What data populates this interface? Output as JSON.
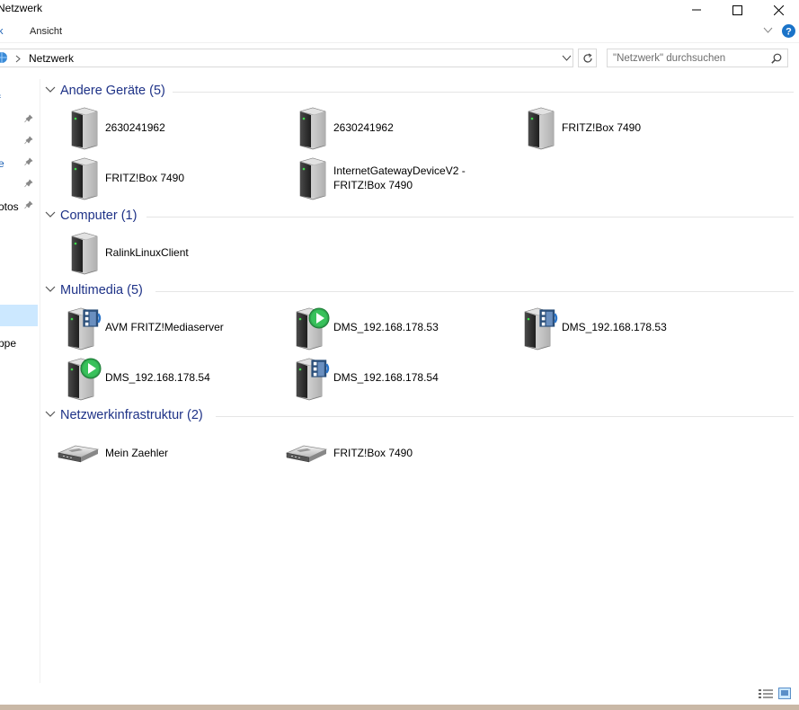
{
  "window": {
    "title": "Netzwerk"
  },
  "ribbon": {
    "tabs": [
      "k",
      "Ansicht"
    ]
  },
  "address": {
    "location": "Netzwerk"
  },
  "search": {
    "placeholder": "\"Netzwerk\" durchsuchen"
  },
  "nav": {
    "items": [
      "f",
      "",
      "e",
      "",
      "otos",
      "",
      "ppe"
    ]
  },
  "groups": [
    {
      "title": "Andere Geräte (5)",
      "items": [
        {
          "label": "2630241962",
          "icon": "server-tower-icon"
        },
        {
          "label": "2630241962",
          "icon": "server-tower-icon"
        },
        {
          "label": "FRITZ!Box 7490",
          "icon": "server-tower-icon"
        },
        {
          "label": "FRITZ!Box 7490",
          "icon": "server-tower-icon"
        },
        {
          "label": "InternetGatewayDeviceV2 -",
          "label2": "FRITZ!Box 7490",
          "icon": "server-tower-icon"
        }
      ]
    },
    {
      "title": "Computer (1)",
      "items": [
        {
          "label": "RalinkLinuxClient",
          "icon": "server-tower-icon"
        }
      ]
    },
    {
      "title": "Multimedia (5)",
      "items": [
        {
          "label": "AVM FRITZ!Mediaserver",
          "icon": "media-server-icon"
        },
        {
          "label": "DMS_192.168.178.53",
          "icon": "media-player-icon"
        },
        {
          "label": "DMS_192.168.178.53",
          "icon": "media-server-icon"
        },
        {
          "label": "DMS_192.168.178.54",
          "icon": "media-player-icon"
        },
        {
          "label": "DMS_192.168.178.54",
          "icon": "media-server-icon"
        }
      ]
    },
    {
      "title": "Netzwerkinfrastruktur (2)",
      "items": [
        {
          "label": "Mein Zaehler",
          "icon": "router-icon"
        },
        {
          "label": "FRITZ!Box 7490",
          "icon": "router-icon"
        }
      ]
    }
  ],
  "colors": {
    "group_title": "#1e3287",
    "nav_selected": "#cce8ff",
    "help": "#1a73c8"
  }
}
